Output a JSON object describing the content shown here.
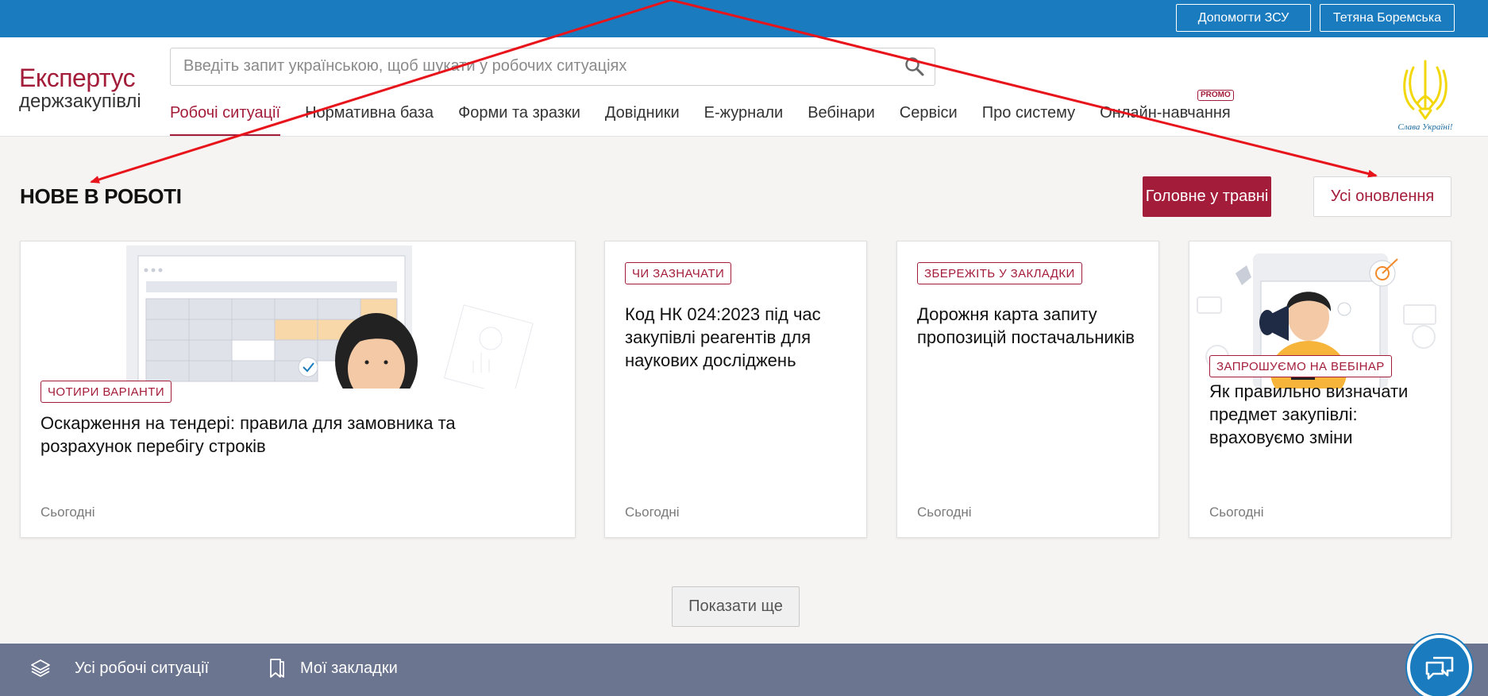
{
  "topbar": {
    "help_label": "Допомогти ЗСУ",
    "user_label": "Тетяна Боремська"
  },
  "logo": {
    "line1": "Експертус",
    "line2": "держзакупівлі"
  },
  "search": {
    "placeholder": "Введіть запит українською, щоб шукати у робочих ситуаціях"
  },
  "nav": {
    "items": [
      {
        "label": "Робочі ситуації",
        "active": true
      },
      {
        "label": "Нормативна база"
      },
      {
        "label": "Форми та зразки"
      },
      {
        "label": "Довідники"
      },
      {
        "label": "Е-журнали"
      },
      {
        "label": "Вебінари"
      },
      {
        "label": "Сервіси"
      },
      {
        "label": "Про систему"
      },
      {
        "label": "Онлайн-навчання",
        "badge": "PROMO"
      }
    ]
  },
  "emblem": {
    "caption": "Слава Україні!"
  },
  "section": {
    "title": "НОВЕ В РОБОТІ",
    "main_button": "Головне у травні",
    "all_button": "Усі оновлення"
  },
  "cards": [
    {
      "tag": "ЧОТИРИ ВАРІАНТИ",
      "title": "Оскарження на тендері: правила для замовника та розрахунок перебігу строків",
      "date": "Сьогодні"
    },
    {
      "tag": "ЧИ ЗАЗНАЧАТИ",
      "title": "Код НК 024:2023 під час закупівлі реагентів для наукових досліджень",
      "date": "Сьогодні"
    },
    {
      "tag": "ЗБЕРЕЖІТЬ У ЗАКЛАДКИ",
      "title": "Дорожня карта запиту пропозицій постачальників",
      "date": "Сьогодні"
    },
    {
      "tag": "ЗАПРОШУЄМО НА ВЕБІНАР",
      "title": "Як правильно визначати предмет закупівлі: враховуємо зміни",
      "date": "Сьогодні"
    }
  ],
  "show_more": "Показати ще",
  "bottom": {
    "all_situations": "Усі робочі ситуації",
    "bookmarks": "Мої закладки"
  },
  "colors": {
    "brand": "#a31d3a",
    "topbar": "#1a7bbf",
    "bottombar": "#6b7590"
  }
}
